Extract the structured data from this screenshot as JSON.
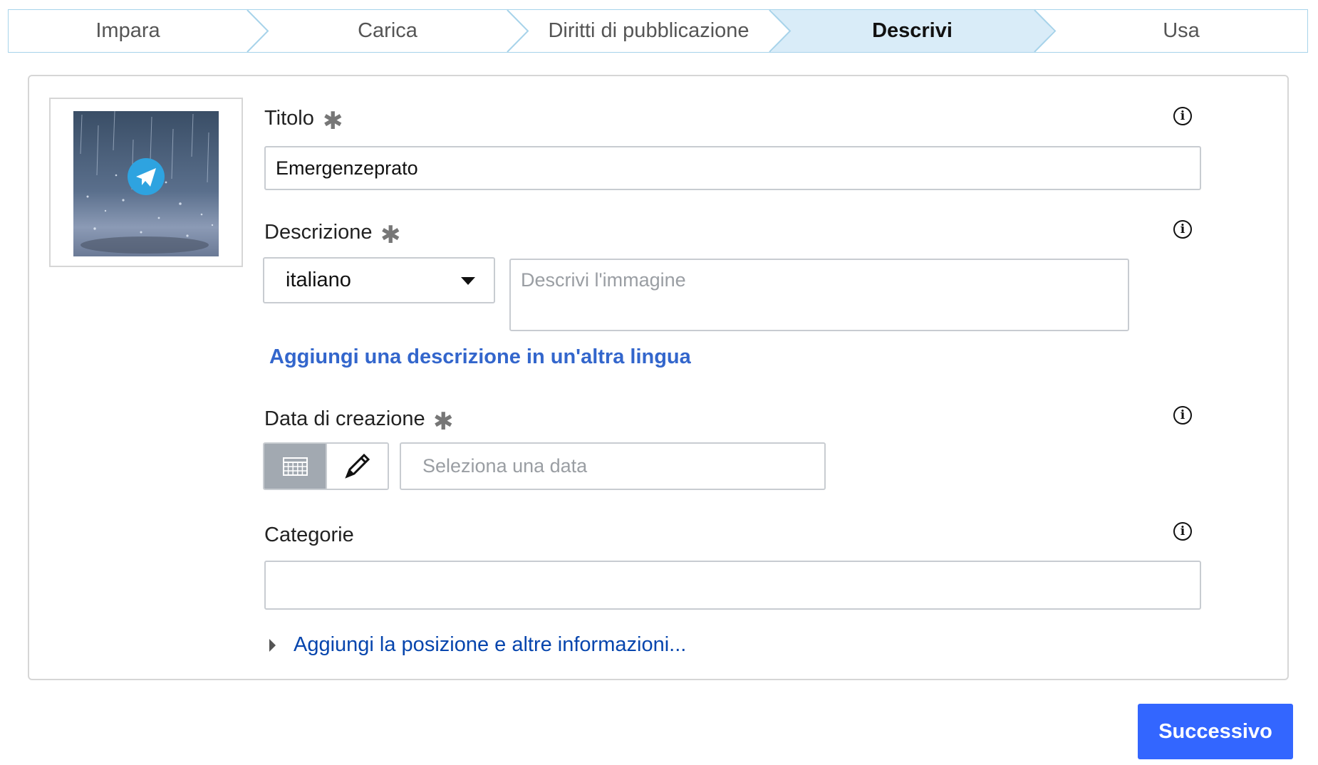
{
  "steps": [
    {
      "label": "Impara",
      "active": false
    },
    {
      "label": "Carica",
      "active": false
    },
    {
      "label": "Diritti di pubblicazione",
      "active": false
    },
    {
      "label": "Descrivi",
      "active": true
    },
    {
      "label": "Usa",
      "active": false
    }
  ],
  "colors": {
    "step_border": "#a7d3ea",
    "step_active_bg": "#d9ecf8",
    "link": "#3366cc",
    "button": "#3366ff"
  },
  "form": {
    "title": {
      "label": "Titolo",
      "required_mark": "✱",
      "value": "Emergenzeprato"
    },
    "description": {
      "label": "Descrizione",
      "required_mark": "✱",
      "language": "italiano",
      "placeholder": "Descrivi l'immagine",
      "add_language_link": "Aggiungi una descrizione in un'altra lingua"
    },
    "date": {
      "label": "Data di creazione",
      "required_mark": "✱",
      "placeholder": "Seleziona una data"
    },
    "categories": {
      "label": "Categorie",
      "value": ""
    },
    "more_info_link": "Aggiungi la posizione e altre informazioni..."
  },
  "next_button": "Successivo",
  "info_glyph": "i"
}
